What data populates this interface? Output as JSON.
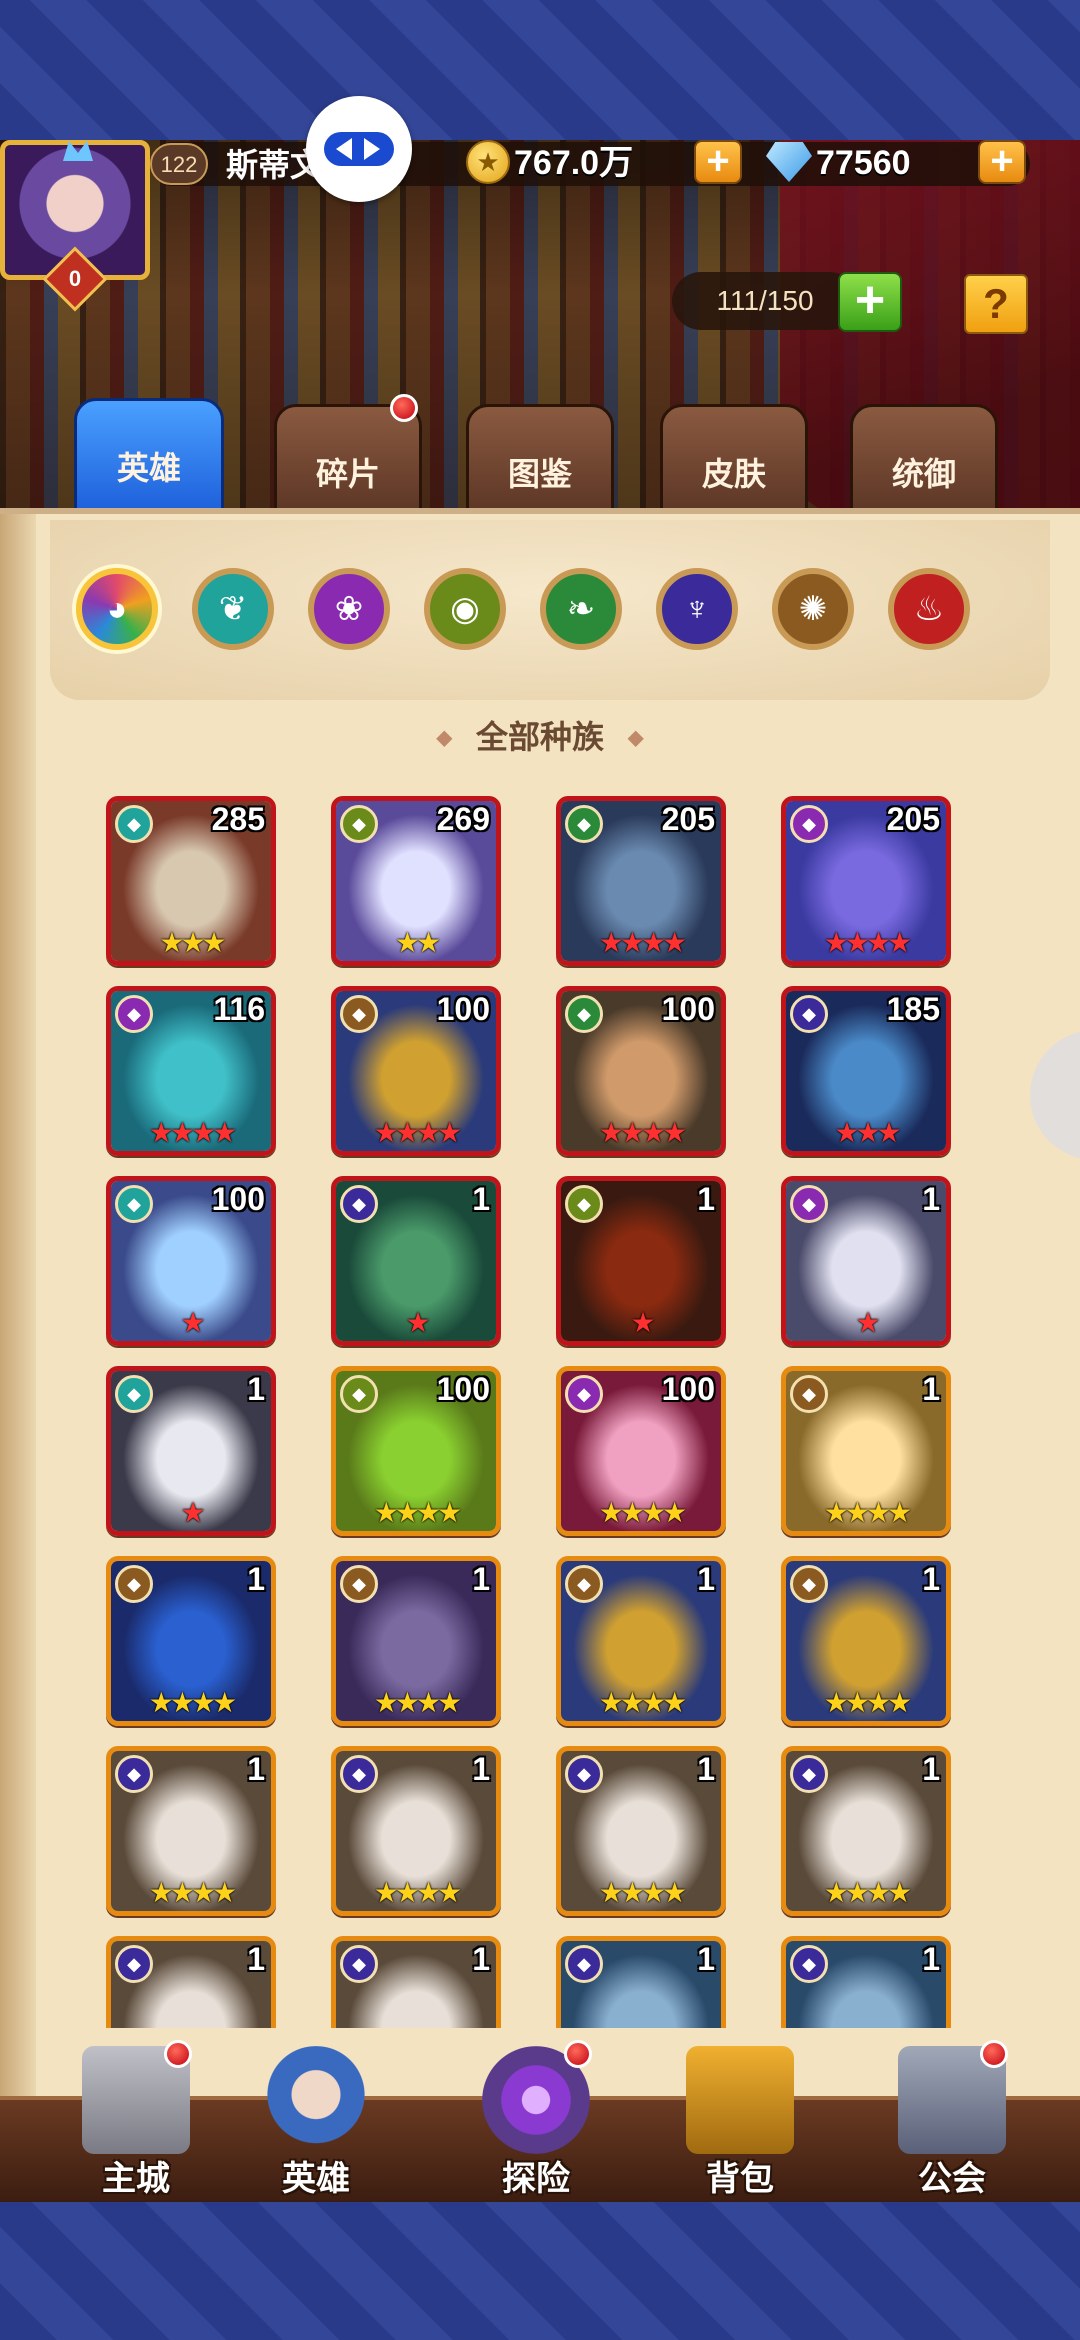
{
  "player": {
    "level": "122",
    "name": "斯蒂文",
    "vip": "0"
  },
  "resources": {
    "gold": "767.0万",
    "gems": "77560",
    "coin_glyph": "★"
  },
  "roster": {
    "count": "111/150"
  },
  "buttons": {
    "plus": "+",
    "help": "?"
  },
  "tabs": [
    {
      "label": "英雄",
      "active": true
    },
    {
      "label": "碎片",
      "badge": true
    },
    {
      "label": "图鉴"
    },
    {
      "label": "皮肤"
    },
    {
      "label": "统御"
    }
  ],
  "factions": [
    {
      "icon": "all-factions-icon",
      "color": "#e24a6a",
      "selected": true
    },
    {
      "icon": "wings-icon",
      "color": "#1fa39a"
    },
    {
      "icon": "lotus-icon",
      "color": "#8a2ab0"
    },
    {
      "icon": "eye-icon",
      "color": "#6a8a1a"
    },
    {
      "icon": "leaf-icon",
      "color": "#2a8a3a"
    },
    {
      "icon": "demon-icon",
      "color": "#3a2a9a"
    },
    {
      "icon": "sun-icon",
      "color": "#8a5a20"
    },
    {
      "icon": "flame-icon",
      "color": "#c02020"
    }
  ],
  "filter_label": "全部种族",
  "heroes": [
    {
      "level": "285",
      "stars": "★★★",
      "star_color": "yellow",
      "frame": "red"
    },
    {
      "level": "269",
      "stars": "★★",
      "star_color": "yellow",
      "frame": "red"
    },
    {
      "level": "205",
      "stars": "★★★★",
      "star_color": "red",
      "frame": "red"
    },
    {
      "level": "205",
      "stars": "★★★★",
      "star_color": "red",
      "frame": "red"
    },
    {
      "level": "116",
      "stars": "★★★★",
      "star_color": "red",
      "frame": "red"
    },
    {
      "level": "100",
      "stars": "★★★★",
      "star_color": "red",
      "frame": "red"
    },
    {
      "level": "100",
      "stars": "★★★★",
      "star_color": "red",
      "frame": "red"
    },
    {
      "level": "185",
      "stars": "★★★",
      "star_color": "red",
      "frame": "red"
    },
    {
      "level": "100",
      "stars": "★",
      "star_color": "red",
      "frame": "red"
    },
    {
      "level": "1",
      "stars": "★",
      "star_color": "red",
      "frame": "red"
    },
    {
      "level": "1",
      "stars": "★",
      "star_color": "red",
      "frame": "red"
    },
    {
      "level": "1",
      "stars": "★",
      "star_color": "red",
      "frame": "red"
    },
    {
      "level": "1",
      "stars": "★",
      "star_color": "red",
      "frame": "red"
    },
    {
      "level": "100",
      "stars": "★★★★",
      "star_color": "yellow",
      "frame": "gold"
    },
    {
      "level": "100",
      "stars": "★★★★",
      "star_color": "yellow",
      "frame": "gold"
    },
    {
      "level": "1",
      "stars": "★★★★",
      "star_color": "yellow",
      "frame": "gold"
    },
    {
      "level": "1",
      "stars": "★★★★",
      "star_color": "yellow",
      "frame": "gold"
    },
    {
      "level": "1",
      "stars": "★★★★",
      "star_color": "yellow",
      "frame": "gold"
    },
    {
      "level": "1",
      "stars": "★★★★",
      "star_color": "yellow",
      "frame": "gold"
    },
    {
      "level": "1",
      "stars": "★★★★",
      "star_color": "yellow",
      "frame": "gold"
    },
    {
      "level": "1",
      "stars": "★★★★",
      "star_color": "yellow",
      "frame": "gold"
    },
    {
      "level": "1",
      "stars": "★★★★",
      "star_color": "yellow",
      "frame": "gold"
    },
    {
      "level": "1",
      "stars": "★★★★",
      "star_color": "yellow",
      "frame": "gold"
    },
    {
      "level": "1",
      "stars": "★★★★",
      "star_color": "yellow",
      "frame": "gold"
    },
    {
      "level": "1",
      "stars": "",
      "star_color": "yellow",
      "frame": "gold"
    },
    {
      "level": "1",
      "stars": "",
      "star_color": "yellow",
      "frame": "gold"
    },
    {
      "level": "1",
      "stars": "",
      "star_color": "yellow",
      "frame": "gold"
    },
    {
      "level": "1",
      "stars": "",
      "star_color": "yellow",
      "frame": "gold"
    }
  ],
  "bottom_nav": [
    {
      "label": "主城",
      "icon": "castle-icon",
      "badge": true
    },
    {
      "label": "英雄",
      "icon": "hero-portrait-icon",
      "badge": false
    },
    {
      "label": "探险",
      "icon": "portal-icon",
      "badge": true
    },
    {
      "label": "背包",
      "icon": "backpack-icon",
      "badge": false
    },
    {
      "label": "公会",
      "icon": "guild-tower-icon",
      "badge": true
    }
  ]
}
